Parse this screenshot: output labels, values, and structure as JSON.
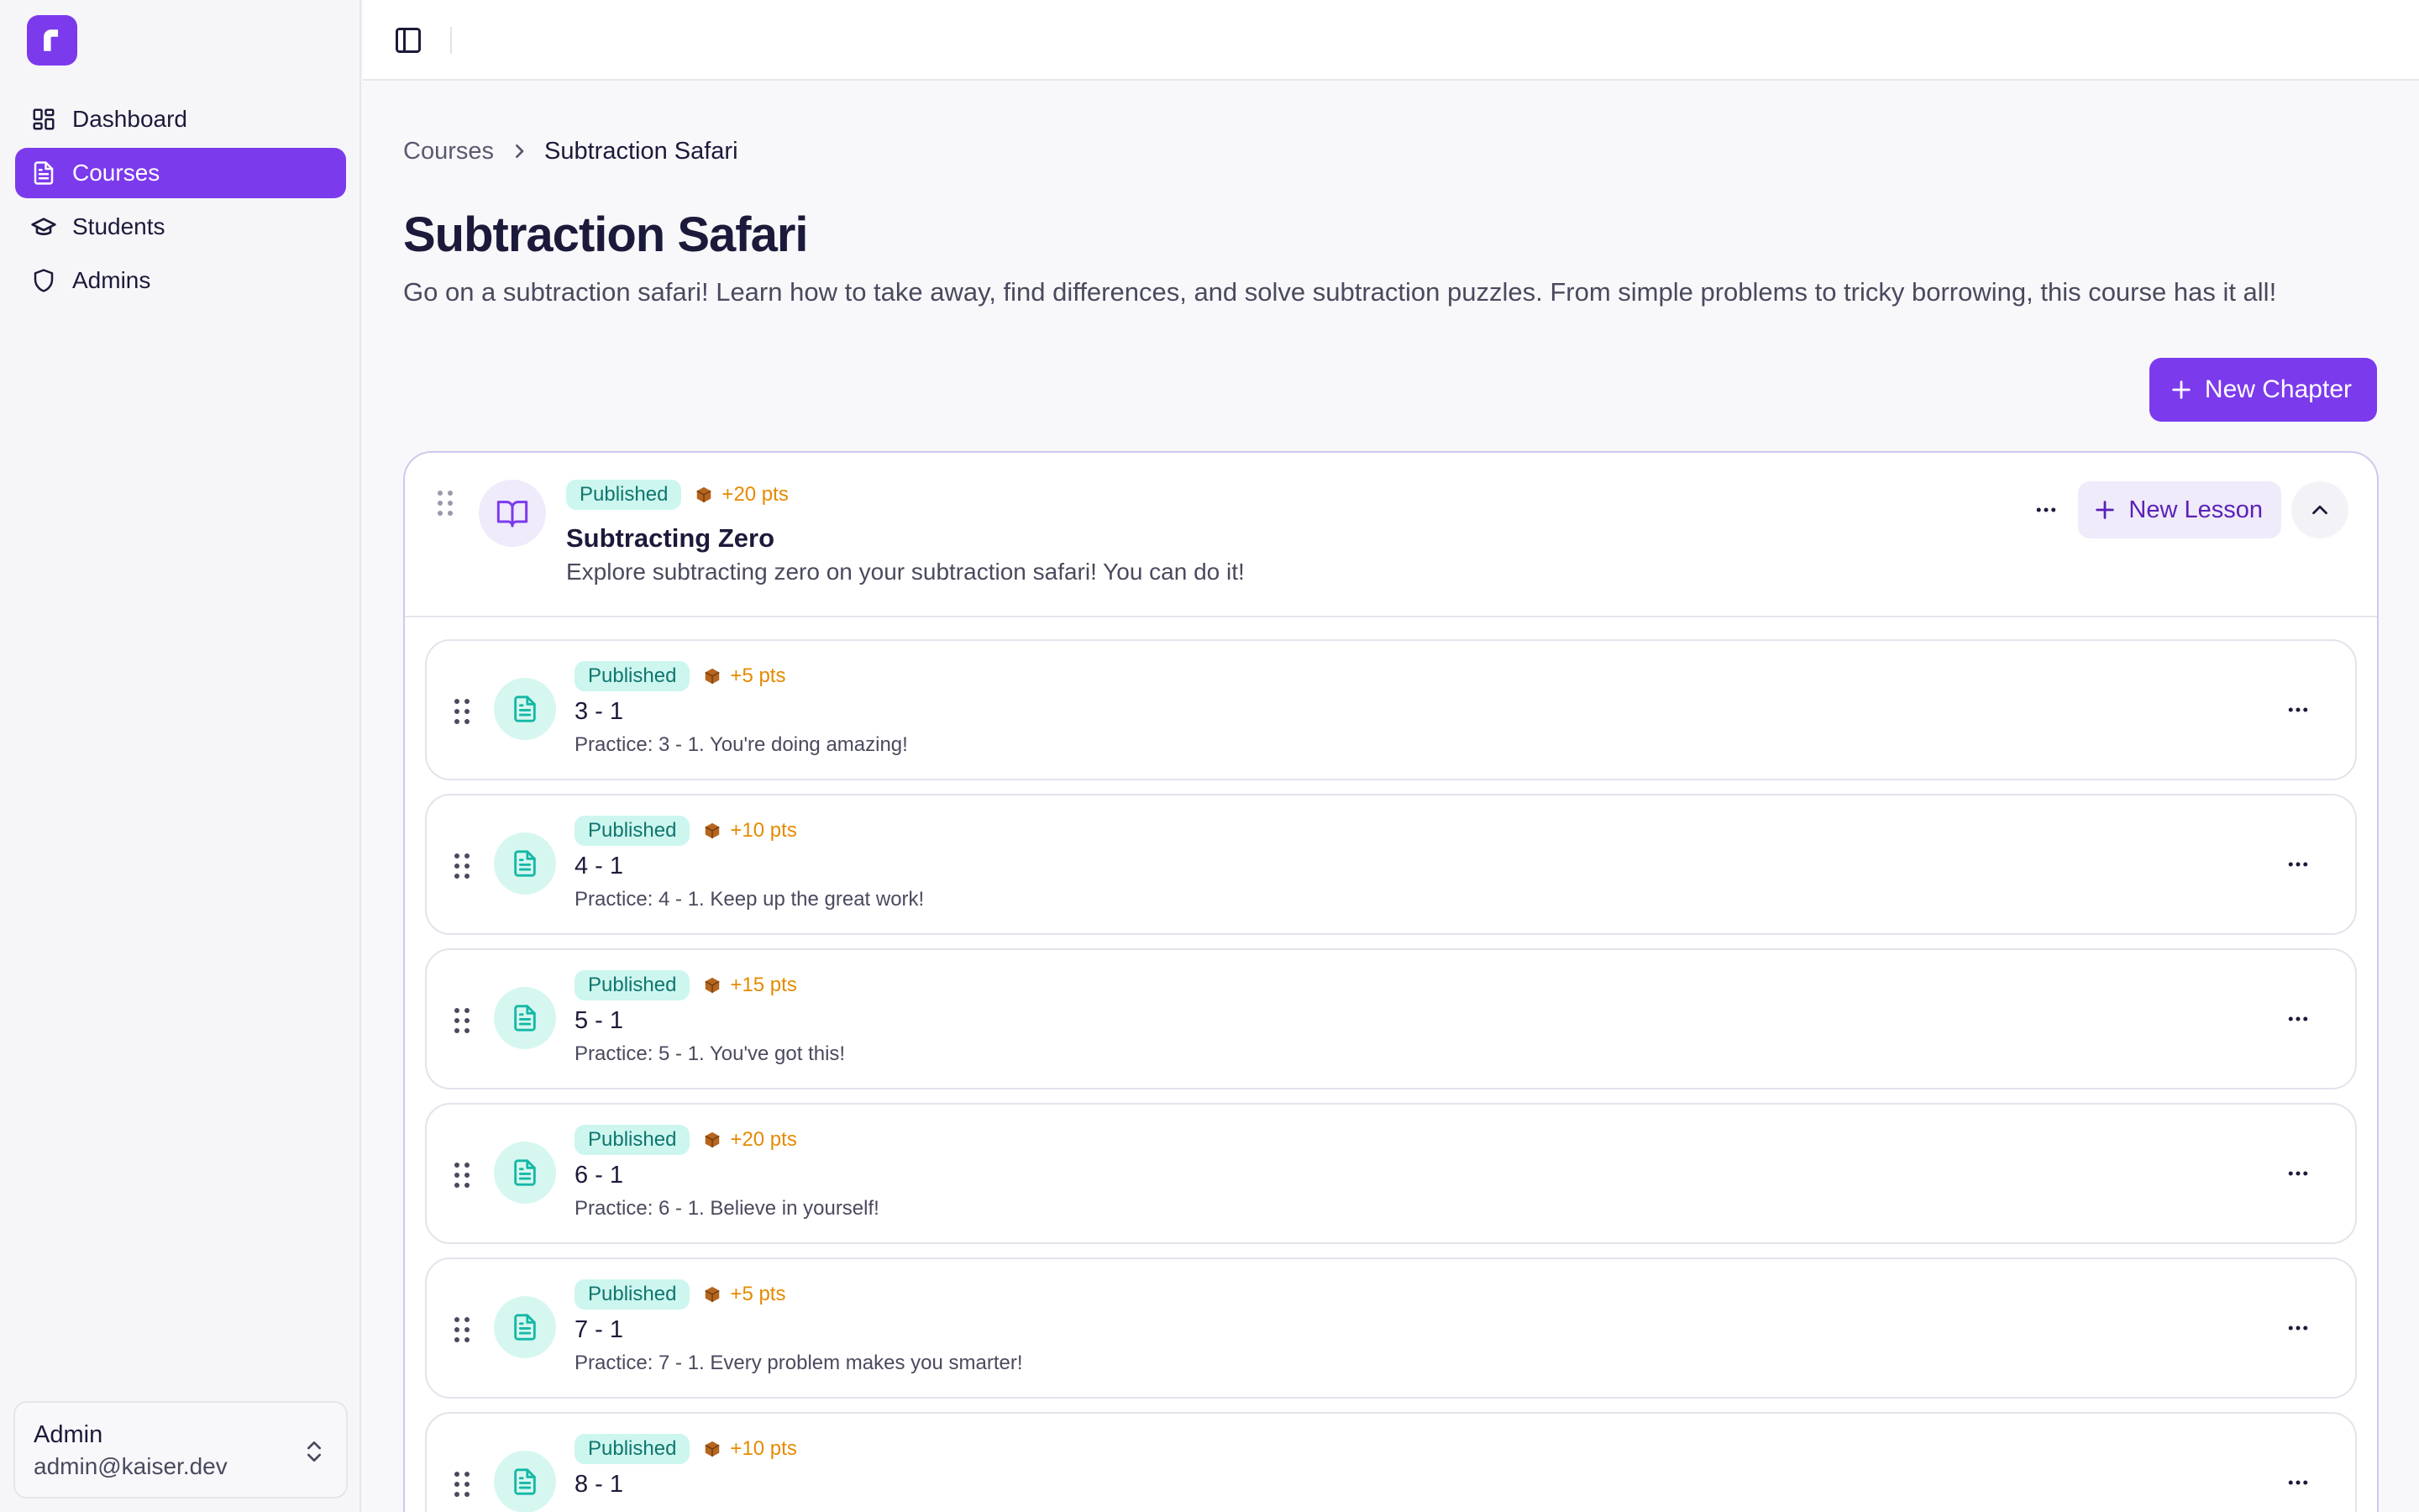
{
  "sidebar": {
    "logo_letter": "r",
    "brand_color": "#7c3aed",
    "items": [
      {
        "label": "Dashboard",
        "icon": "dashboard-icon",
        "active": false
      },
      {
        "label": "Courses",
        "icon": "document-icon",
        "active": true
      },
      {
        "label": "Students",
        "icon": "graduation-cap-icon",
        "active": false
      },
      {
        "label": "Admins",
        "icon": "shield-icon",
        "active": false
      }
    ],
    "user": {
      "name": "Admin",
      "email": "admin@kaiser.dev"
    }
  },
  "breadcrumb": {
    "parent": "Courses",
    "current": "Subtraction Safari"
  },
  "page": {
    "title": "Subtraction Safari",
    "description": "Go on a subtraction safari! Learn how to take away, find differences, and solve subtraction puzzles. From simple problems to tricky borrowing, this course has it all!",
    "new_chapter_label": "New Chapter"
  },
  "chapter": {
    "status": "Published",
    "points": "+20 pts",
    "title": "Subtracting Zero",
    "description": "Explore subtracting zero on your subtraction safari! You can do it!",
    "new_lesson_label": "New Lesson",
    "lessons": [
      {
        "status": "Published",
        "points": "+5 pts",
        "title": "3 - 1",
        "description": "Practice: 3 - 1. You're doing amazing!"
      },
      {
        "status": "Published",
        "points": "+10 pts",
        "title": "4 - 1",
        "description": "Practice: 4 - 1. Keep up the great work!"
      },
      {
        "status": "Published",
        "points": "+15 pts",
        "title": "5 - 1",
        "description": "Practice: 5 - 1. You've got this!"
      },
      {
        "status": "Published",
        "points": "+20 pts",
        "title": "6 - 1",
        "description": "Practice: 6 - 1. Believe in yourself!"
      },
      {
        "status": "Published",
        "points": "+5 pts",
        "title": "7 - 1",
        "description": "Practice: 7 - 1. Every problem makes you smarter!"
      },
      {
        "status": "Published",
        "points": "+10 pts",
        "title": "8 - 1",
        "description": ""
      }
    ]
  },
  "colors": {
    "accent": "#7c3aed",
    "published_badge_bg": "#cdf6ef",
    "published_badge_text": "#0f766e",
    "points": "#e58a00"
  }
}
